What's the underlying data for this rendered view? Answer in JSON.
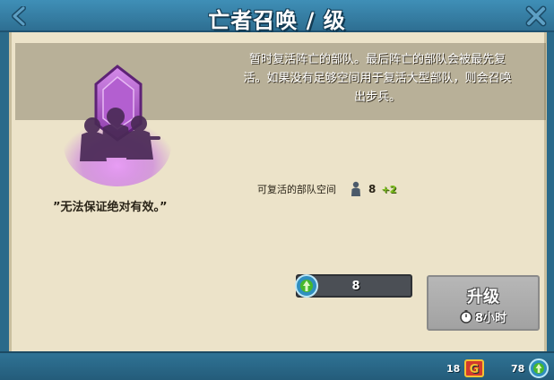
{
  "header": {
    "title": "亡者召唤 / 级"
  },
  "description": {
    "lines": [
      "暂时复活阵亡的部队。最后阵亡的部队会被最先复",
      "活。如果没有足够空间用于复活大型部队，则会召唤",
      "出步兵。"
    ]
  },
  "quote": "”无法保证绝对有效。”",
  "stat": {
    "label": "可复活的部队空间",
    "value": "8",
    "bonus": "+2"
  },
  "cost": {
    "value": "8"
  },
  "upgrade": {
    "label": "升级",
    "time": "8小时"
  },
  "footer": {
    "gems": "18",
    "potions": "78"
  },
  "colors": {
    "header": "#2e6f92",
    "parchment": "#ece3c9",
    "spell_purple": "#b24fd6",
    "bonus_green": "#7dbf1e"
  },
  "icons": {
    "back": "chevron-left-icon",
    "close": "close-icon",
    "spell": "troop-revival-spell-icon",
    "troop": "soldier-icon",
    "cost": "potion-icon",
    "timer": "stopwatch-icon",
    "gem": "gem-chest-icon",
    "footer_potion": "potion-icon"
  }
}
